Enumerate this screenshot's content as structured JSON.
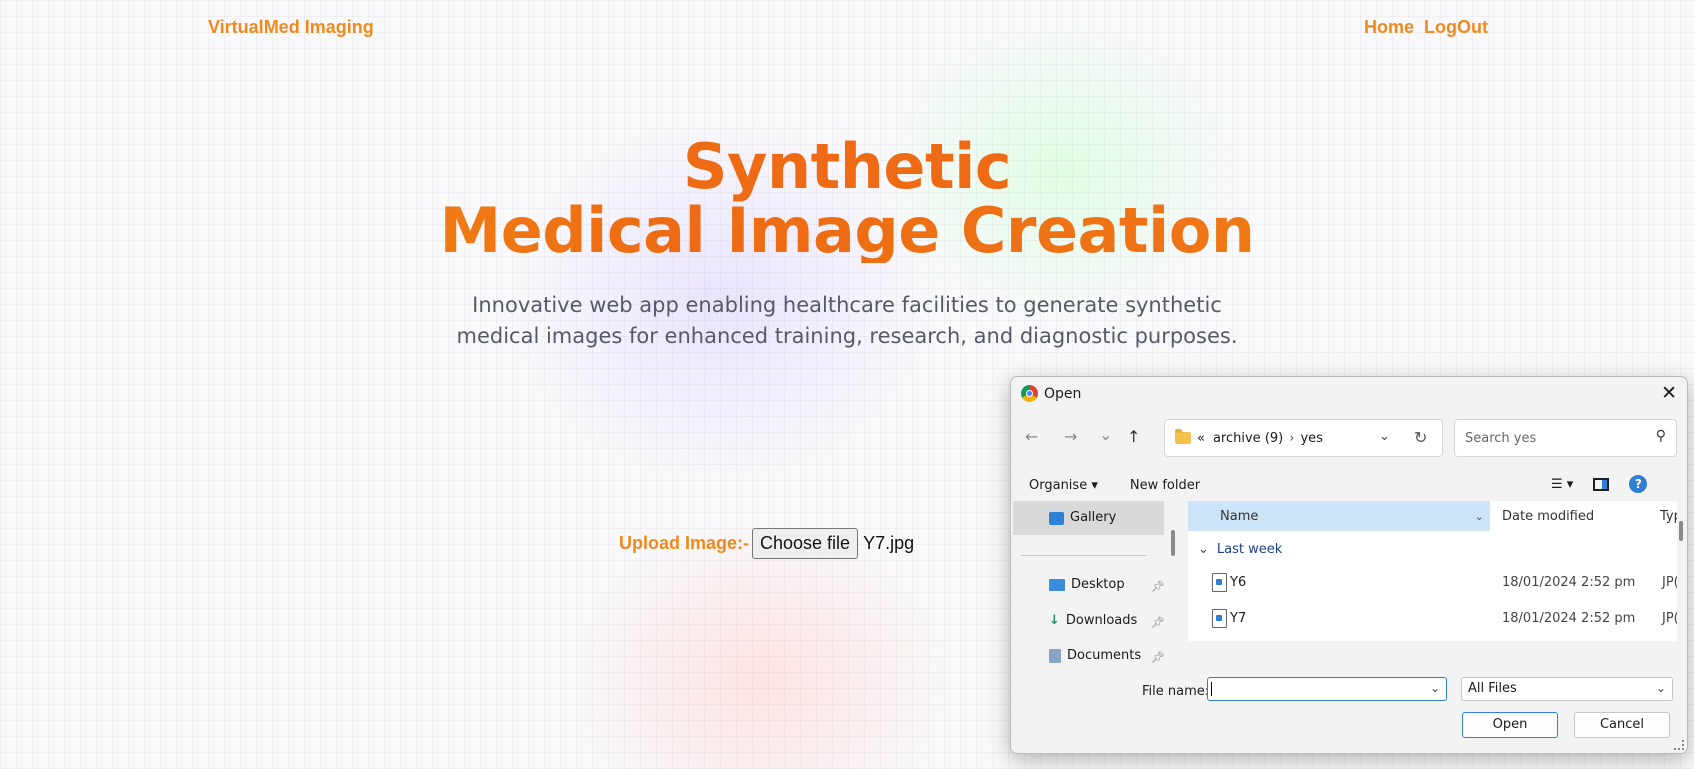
{
  "nav": {
    "brand": "VirtualMed Imaging",
    "links": [
      "Home",
      "LogOut"
    ]
  },
  "hero": {
    "line1": "Synthetic",
    "line2": "Medical Image Creation",
    "subtitle_line1": "Innovative web app enabling healthcare facilities to generate synthetic",
    "subtitle_line2": "medical images for enhanced training, research, and diagnostic purposes."
  },
  "upload": {
    "label": "Upload Image:-",
    "button": "Choose file",
    "chosen_file": "Y7.jpg"
  },
  "dialog": {
    "title": "Open",
    "close": "✕",
    "back": "←",
    "forward": "→",
    "recent": "⌄",
    "up": "↑",
    "breadcrumb": [
      "«",
      "archive (9)",
      "›",
      "yes"
    ],
    "search_placeholder": "Search yes",
    "toolbar": {
      "organise": "Organise ▾",
      "new_folder": "New folder"
    },
    "nav_items": [
      {
        "label": "Gallery",
        "selected": true
      },
      {
        "label": "Desktop",
        "pinned": true
      },
      {
        "label": "Downloads",
        "pinned": true
      },
      {
        "label": "Documents",
        "pinned": true
      }
    ],
    "columns": {
      "name": "Name",
      "date": "Date modified",
      "type": "Typ"
    },
    "group": "Last week",
    "files": [
      {
        "name": "Y6",
        "date": "18/01/2024 2:52 pm",
        "type": "JP("
      },
      {
        "name": "Y7",
        "date": "18/01/2024 2:52 pm",
        "type": "JP("
      }
    ],
    "file_name_label": "File name:",
    "file_name_value": "",
    "file_type": "All Files",
    "open_button": "Open",
    "cancel_button": "Cancel"
  },
  "colors": {
    "accent": "#f08a1c",
    "hero_orange": "#ef6a14",
    "dialog_blue": "#2f7fd4"
  }
}
